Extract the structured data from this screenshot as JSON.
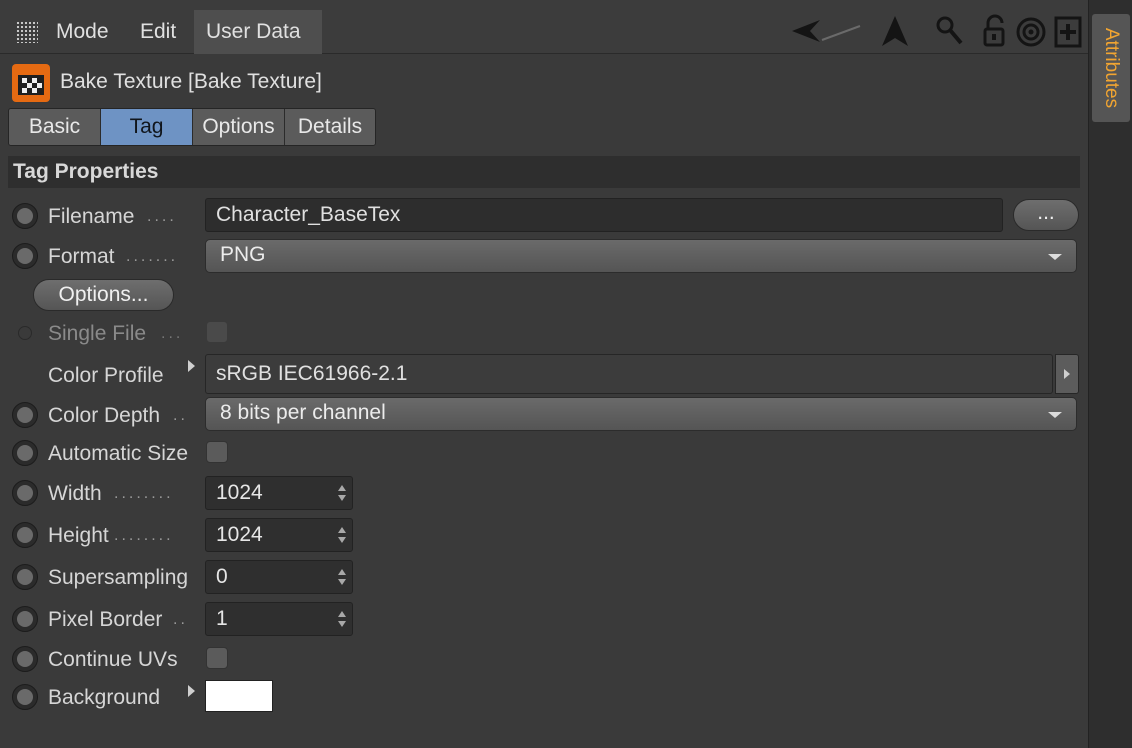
{
  "menubar": {
    "items": [
      "Mode",
      "Edit",
      "User Data"
    ],
    "active_index": 2,
    "tools": [
      "back-arrow-icon",
      "cursor-arrow-icon",
      "search-icon",
      "lock-icon",
      "target-icon",
      "new-panel-icon"
    ]
  },
  "side_tab": {
    "label": "Attributes",
    "color": "#f2a531"
  },
  "object": {
    "title": "Bake Texture [Bake Texture]",
    "icon": "bake-texture-icon",
    "icon_color": "#e56a12"
  },
  "tabs": [
    {
      "label": "Basic",
      "active": false
    },
    {
      "label": "Tag",
      "active": true
    },
    {
      "label": "Options",
      "active": false
    },
    {
      "label": "Details",
      "active": false
    }
  ],
  "section": {
    "title": "Tag Properties"
  },
  "props": {
    "filename": {
      "label": "Filename",
      "value": "Character_BaseTex",
      "browse_label": "..."
    },
    "format": {
      "label": "Format",
      "value": "PNG"
    },
    "options_button": "Options...",
    "single_file": {
      "label": "Single File",
      "checked": false,
      "enabled": false
    },
    "color_profile": {
      "label": "Color Profile",
      "value": "sRGB IEC61966-2.1"
    },
    "color_depth": {
      "label": "Color Depth",
      "value": "8 bits per channel"
    },
    "automatic_size": {
      "label": "Automatic Size",
      "checked": false
    },
    "width": {
      "label": "Width",
      "value": "1024"
    },
    "height": {
      "label": "Height",
      "value": "1024"
    },
    "supersampling": {
      "label": "Supersampling",
      "value": "0"
    },
    "pixel_border": {
      "label": "Pixel Border",
      "value": "1"
    },
    "continue_uvs": {
      "label": "Continue UVs",
      "checked": false
    },
    "background": {
      "label": "Background",
      "color": "#ffffff"
    }
  }
}
